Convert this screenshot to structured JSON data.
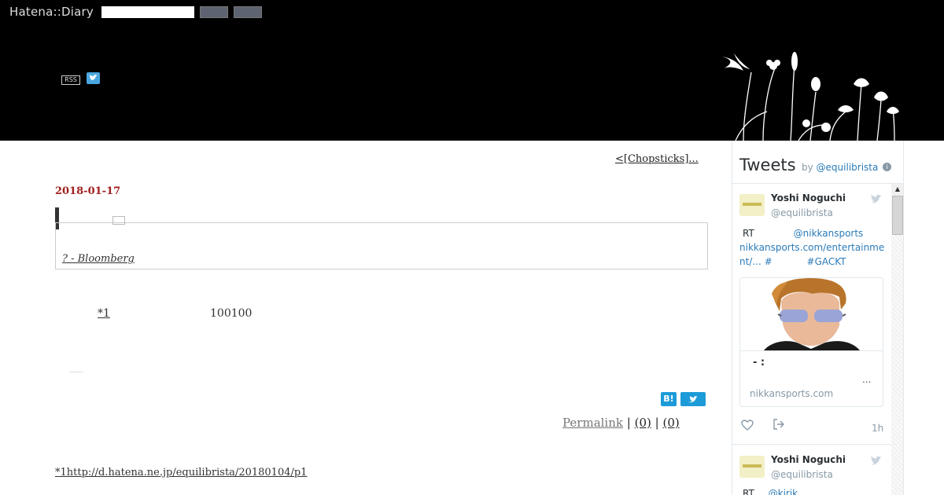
{
  "header": {
    "logo": "Hatena::Diary",
    "rss_label": "RSS",
    "icons": [
      "twitter-icon",
      "flowers-decoration"
    ]
  },
  "main": {
    "prev_link": "<[Chopsticks]...",
    "date": "2018-01-17",
    "quote_source": "? - Bloomberg",
    "footnote_ref": "*1",
    "body_number": "100100",
    "hatena_bookmark_label": "B!",
    "permalink": "Permalink",
    "sep": "|",
    "count_a": "(0)",
    "count_b": "(0)",
    "footnote": "*1http://d.hatena.ne.jp/equilibrista/20180104/p1"
  },
  "tweets": {
    "title": "Tweets",
    "by_label": "by",
    "by_handle": "@equilibrista",
    "info_icon": "i",
    "items": [
      {
        "name": "Yoshi Noguchi",
        "handle": "@equilibrista",
        "rt": "RT",
        "mention": "@nikkansports",
        "link": "nikkansports.com/entertainment/...",
        "hash1": "#",
        "hash2": "#GACKT",
        "card_title": "- :",
        "card_desc": "...",
        "card_domain": "nikkansports.com",
        "time": "1h"
      },
      {
        "name": "Yoshi Noguchi",
        "handle": "@equilibrista",
        "rt": "RT",
        "mention": "@kirik"
      }
    ]
  },
  "colors": {
    "header_bg": "#000000",
    "date": "#a1201e",
    "twitter_blue": "#1d9bd9",
    "link_blue": "#2b7bb9"
  }
}
